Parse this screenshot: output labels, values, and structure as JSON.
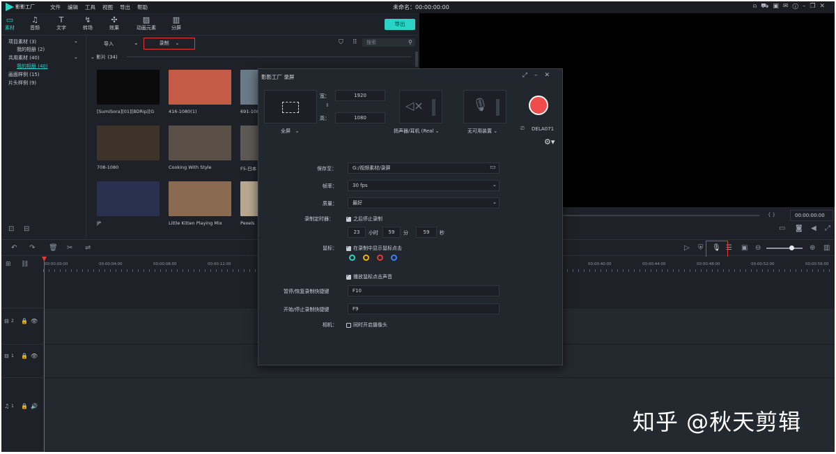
{
  "menubar": {
    "app_name": "影影工厂",
    "items": [
      "文件",
      "编辑",
      "工具",
      "视图",
      "导出",
      "帮助"
    ],
    "project_title": "未命名：",
    "timecode": "00:00:00:00"
  },
  "toolbar": {
    "tools": [
      {
        "label": "素材",
        "icon": "folder-icon"
      },
      {
        "label": "音频",
        "icon": "music-note-icon"
      },
      {
        "label": "文字",
        "icon": "text-icon"
      },
      {
        "label": "转场",
        "icon": "transition-icon"
      },
      {
        "label": "效果",
        "icon": "effects-icon"
      },
      {
        "label": "动画元素",
        "icon": "elements-icon"
      },
      {
        "label": "分屏",
        "icon": "split-screen-icon"
      }
    ],
    "export_label": "导出"
  },
  "sidebar": {
    "items": [
      {
        "label": "项目素材 (3)",
        "indent": 0,
        "expandable": true
      },
      {
        "label": "我的相册 (2)",
        "indent": 1,
        "expandable": false
      },
      {
        "label": "共用素材 (40)",
        "indent": 0,
        "expandable": true
      },
      {
        "label": "我的相册 (40)",
        "indent": 1,
        "expandable": false,
        "selected": true
      },
      {
        "label": "画面样例 (15)",
        "indent": 0,
        "expandable": false
      },
      {
        "label": "片头样例 (9)",
        "indent": 0,
        "expandable": false
      }
    ]
  },
  "content": {
    "import_label": "导入",
    "record_label": "录制",
    "search_placeholder": "搜索",
    "section_label": "影片 (34)",
    "media": [
      {
        "label": "[SumiSora][01][BDRip][G",
        "color": "#0b0b0b"
      },
      {
        "label": "416-1080(1)",
        "color": "#c45a48"
      },
      {
        "label": "691-108",
        "color": "#6a7a88"
      },
      {
        "label": "708-1080",
        "color": "#3d3328"
      },
      {
        "label": "Cooking With Style",
        "color": "#5b5048"
      },
      {
        "label": "F5-日本",
        "color": "#5d5a55"
      },
      {
        "label": "JP",
        "color": "#2a3050"
      },
      {
        "label": "Little Kitten Playing Mix",
        "color": "#8a6a50"
      },
      {
        "label": "Pexels",
        "color": "#b8a890"
      }
    ]
  },
  "preview": {
    "timecode": "00:00:00:00",
    "brackets": "{ }"
  },
  "timeline": {
    "ticks": [
      "00:00:00:00",
      "00:00:04:00",
      "00:00:08:00",
      "00:00:12:00",
      "00:00:40:00",
      "00:00:44:00",
      "00:00:48:00",
      "00:00:52:00",
      "00:00:56:00"
    ],
    "tracks": [
      {
        "name": "2",
        "type": "video"
      },
      {
        "name": "1",
        "type": "video"
      },
      {
        "name": "1",
        "type": "audio"
      }
    ]
  },
  "dialog": {
    "title": "影影工厂 录屏",
    "area_label": "全屏",
    "width_label": "宽：",
    "width_value": "1920",
    "height_label": "高：",
    "height_value": "1080",
    "speaker_label": "扬声器/耳机 (Real",
    "mic_label": "无可用装置",
    "display_label": "DELA071",
    "save_label": "保存至：",
    "save_value": "G:/视频素材/录屏",
    "fps_label": "帧率：",
    "fps_value": "30 fps",
    "quality_label": "质量：",
    "quality_value": "最好",
    "timer_label": "录制定时器：",
    "timer_check": "之后停止录制",
    "timer_hours": "23",
    "hours_unit": "小时",
    "timer_minutes": "59",
    "minutes_unit": "分",
    "timer_seconds": "59",
    "seconds_unit": "秒",
    "mouse_label": "鼠标：",
    "mouse_check": "在录制中显示鼠标点击",
    "cursor_colors": [
      "#2ad3c5",
      "#f2b400",
      "#e53935",
      "#3b82f6"
    ],
    "click_sound_check": "播放鼠标点击声音",
    "pause_hotkey_label": "暂停/恢复录制快捷键",
    "pause_hotkey_value": "F10",
    "start_hotkey_label": "开始/停止录制快捷键",
    "start_hotkey_value": "F9",
    "camera_label": "相机：",
    "camera_check": "同时开启摄像头"
  },
  "watermark": "知乎 @秋天剪辑"
}
